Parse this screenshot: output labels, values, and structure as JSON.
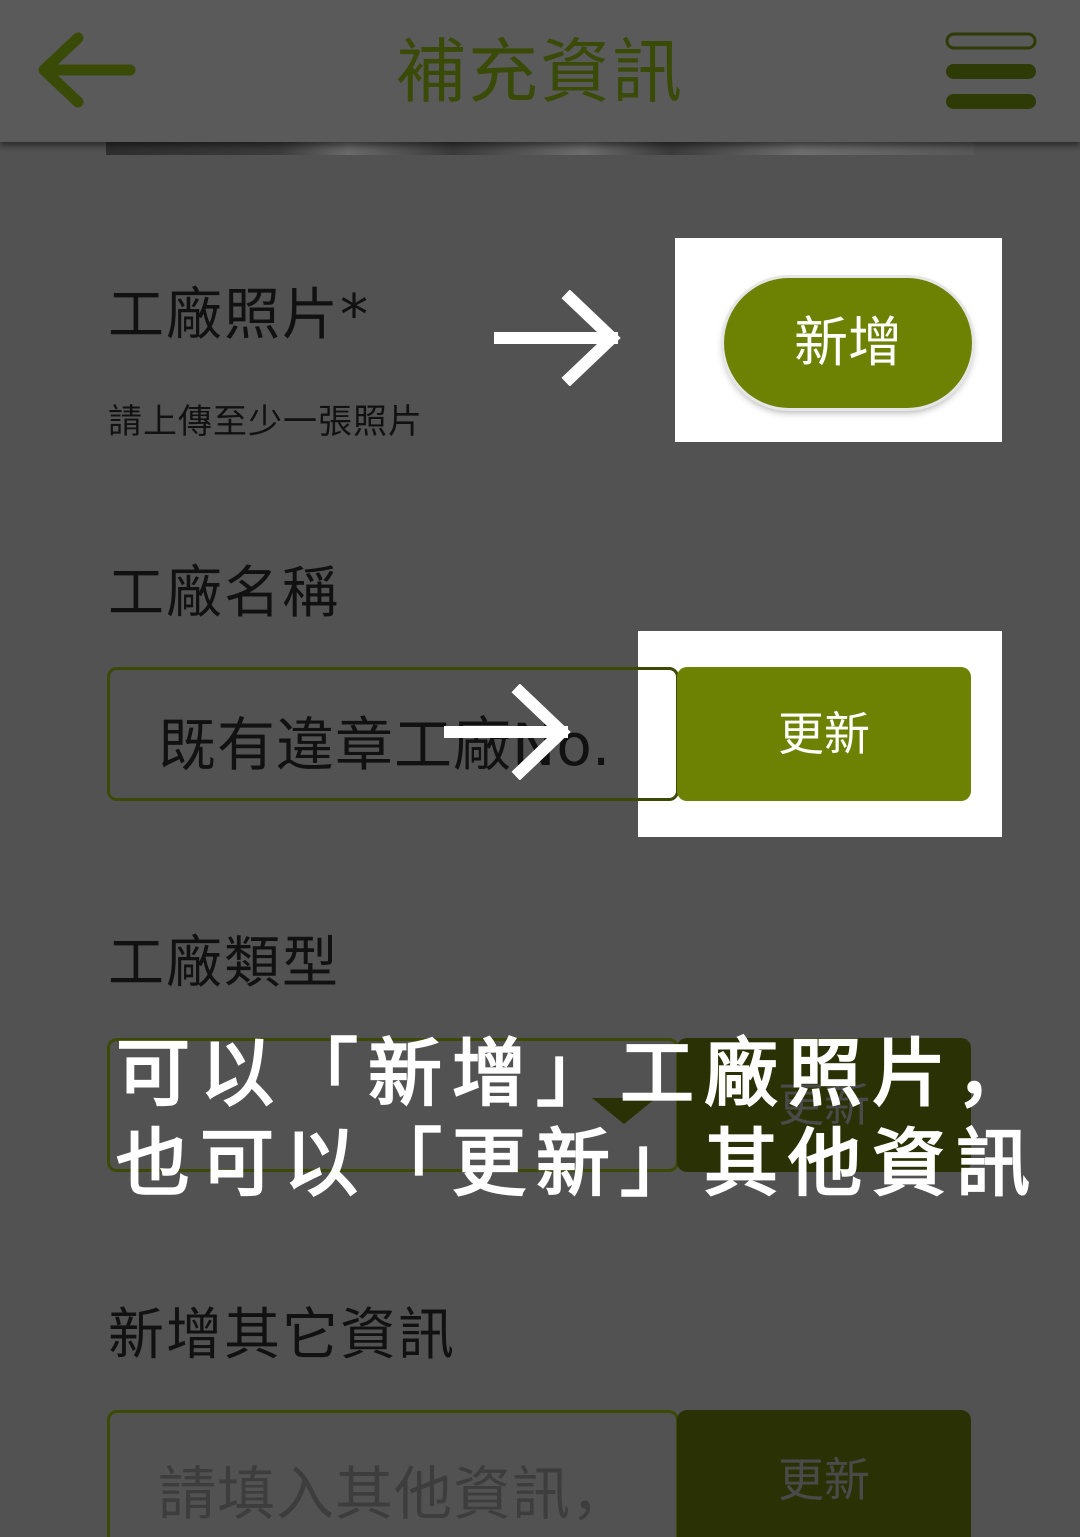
{
  "header": {
    "title": "補充資訊",
    "back_icon": "arrow-left-icon",
    "menu_icon": "hamburger-menu-icon"
  },
  "photo_section": {
    "label": "工廠照片*",
    "hint": "請上傳至少一張照片",
    "add_button": "新增"
  },
  "name_section": {
    "label": "工廠名稱",
    "value": "既有違章工廠No.",
    "update_button": "更新"
  },
  "type_section": {
    "label": "工廠類型",
    "update_button": "更新"
  },
  "other_section": {
    "label": "新增其它資訊",
    "placeholder": "請填入其他資訊，",
    "update_button": "更新"
  },
  "annotation": {
    "line1": "可以「新增」工廠照片，",
    "line2": "也可以「更新」其他資訊"
  },
  "colors": {
    "accent": "#6d8203",
    "header_text": "#3a4a07",
    "overlay_background": "#525252",
    "highlight": "#ffffff"
  }
}
